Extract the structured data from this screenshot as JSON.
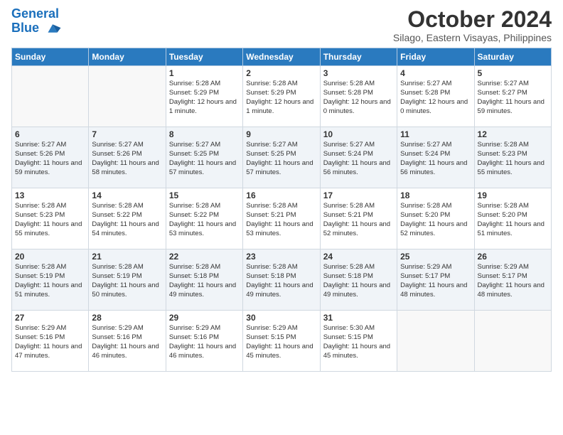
{
  "header": {
    "logo_line1": "General",
    "logo_line2": "Blue",
    "month": "October 2024",
    "location": "Silago, Eastern Visayas, Philippines"
  },
  "days_of_week": [
    "Sunday",
    "Monday",
    "Tuesday",
    "Wednesday",
    "Thursday",
    "Friday",
    "Saturday"
  ],
  "weeks": [
    [
      {
        "day": "",
        "sunrise": "",
        "sunset": "",
        "daylight": ""
      },
      {
        "day": "",
        "sunrise": "",
        "sunset": "",
        "daylight": ""
      },
      {
        "day": "1",
        "sunrise": "Sunrise: 5:28 AM",
        "sunset": "Sunset: 5:29 PM",
        "daylight": "Daylight: 12 hours and 1 minute."
      },
      {
        "day": "2",
        "sunrise": "Sunrise: 5:28 AM",
        "sunset": "Sunset: 5:29 PM",
        "daylight": "Daylight: 12 hours and 1 minute."
      },
      {
        "day": "3",
        "sunrise": "Sunrise: 5:28 AM",
        "sunset": "Sunset: 5:28 PM",
        "daylight": "Daylight: 12 hours and 0 minutes."
      },
      {
        "day": "4",
        "sunrise": "Sunrise: 5:27 AM",
        "sunset": "Sunset: 5:28 PM",
        "daylight": "Daylight: 12 hours and 0 minutes."
      },
      {
        "day": "5",
        "sunrise": "Sunrise: 5:27 AM",
        "sunset": "Sunset: 5:27 PM",
        "daylight": "Daylight: 11 hours and 59 minutes."
      }
    ],
    [
      {
        "day": "6",
        "sunrise": "Sunrise: 5:27 AM",
        "sunset": "Sunset: 5:26 PM",
        "daylight": "Daylight: 11 hours and 59 minutes."
      },
      {
        "day": "7",
        "sunrise": "Sunrise: 5:27 AM",
        "sunset": "Sunset: 5:26 PM",
        "daylight": "Daylight: 11 hours and 58 minutes."
      },
      {
        "day": "8",
        "sunrise": "Sunrise: 5:27 AM",
        "sunset": "Sunset: 5:25 PM",
        "daylight": "Daylight: 11 hours and 57 minutes."
      },
      {
        "day": "9",
        "sunrise": "Sunrise: 5:27 AM",
        "sunset": "Sunset: 5:25 PM",
        "daylight": "Daylight: 11 hours and 57 minutes."
      },
      {
        "day": "10",
        "sunrise": "Sunrise: 5:27 AM",
        "sunset": "Sunset: 5:24 PM",
        "daylight": "Daylight: 11 hours and 56 minutes."
      },
      {
        "day": "11",
        "sunrise": "Sunrise: 5:27 AM",
        "sunset": "Sunset: 5:24 PM",
        "daylight": "Daylight: 11 hours and 56 minutes."
      },
      {
        "day": "12",
        "sunrise": "Sunrise: 5:28 AM",
        "sunset": "Sunset: 5:23 PM",
        "daylight": "Daylight: 11 hours and 55 minutes."
      }
    ],
    [
      {
        "day": "13",
        "sunrise": "Sunrise: 5:28 AM",
        "sunset": "Sunset: 5:23 PM",
        "daylight": "Daylight: 11 hours and 55 minutes."
      },
      {
        "day": "14",
        "sunrise": "Sunrise: 5:28 AM",
        "sunset": "Sunset: 5:22 PM",
        "daylight": "Daylight: 11 hours and 54 minutes."
      },
      {
        "day": "15",
        "sunrise": "Sunrise: 5:28 AM",
        "sunset": "Sunset: 5:22 PM",
        "daylight": "Daylight: 11 hours and 53 minutes."
      },
      {
        "day": "16",
        "sunrise": "Sunrise: 5:28 AM",
        "sunset": "Sunset: 5:21 PM",
        "daylight": "Daylight: 11 hours and 53 minutes."
      },
      {
        "day": "17",
        "sunrise": "Sunrise: 5:28 AM",
        "sunset": "Sunset: 5:21 PM",
        "daylight": "Daylight: 11 hours and 52 minutes."
      },
      {
        "day": "18",
        "sunrise": "Sunrise: 5:28 AM",
        "sunset": "Sunset: 5:20 PM",
        "daylight": "Daylight: 11 hours and 52 minutes."
      },
      {
        "day": "19",
        "sunrise": "Sunrise: 5:28 AM",
        "sunset": "Sunset: 5:20 PM",
        "daylight": "Daylight: 11 hours and 51 minutes."
      }
    ],
    [
      {
        "day": "20",
        "sunrise": "Sunrise: 5:28 AM",
        "sunset": "Sunset: 5:19 PM",
        "daylight": "Daylight: 11 hours and 51 minutes."
      },
      {
        "day": "21",
        "sunrise": "Sunrise: 5:28 AM",
        "sunset": "Sunset: 5:19 PM",
        "daylight": "Daylight: 11 hours and 50 minutes."
      },
      {
        "day": "22",
        "sunrise": "Sunrise: 5:28 AM",
        "sunset": "Sunset: 5:18 PM",
        "daylight": "Daylight: 11 hours and 49 minutes."
      },
      {
        "day": "23",
        "sunrise": "Sunrise: 5:28 AM",
        "sunset": "Sunset: 5:18 PM",
        "daylight": "Daylight: 11 hours and 49 minutes."
      },
      {
        "day": "24",
        "sunrise": "Sunrise: 5:28 AM",
        "sunset": "Sunset: 5:18 PM",
        "daylight": "Daylight: 11 hours and 49 minutes."
      },
      {
        "day": "25",
        "sunrise": "Sunrise: 5:29 AM",
        "sunset": "Sunset: 5:17 PM",
        "daylight": "Daylight: 11 hours and 48 minutes."
      },
      {
        "day": "26",
        "sunrise": "Sunrise: 5:29 AM",
        "sunset": "Sunset: 5:17 PM",
        "daylight": "Daylight: 11 hours and 48 minutes."
      }
    ],
    [
      {
        "day": "27",
        "sunrise": "Sunrise: 5:29 AM",
        "sunset": "Sunset: 5:16 PM",
        "daylight": "Daylight: 11 hours and 47 minutes."
      },
      {
        "day": "28",
        "sunrise": "Sunrise: 5:29 AM",
        "sunset": "Sunset: 5:16 PM",
        "daylight": "Daylight: 11 hours and 46 minutes."
      },
      {
        "day": "29",
        "sunrise": "Sunrise: 5:29 AM",
        "sunset": "Sunset: 5:16 PM",
        "daylight": "Daylight: 11 hours and 46 minutes."
      },
      {
        "day": "30",
        "sunrise": "Sunrise: 5:29 AM",
        "sunset": "Sunset: 5:15 PM",
        "daylight": "Daylight: 11 hours and 45 minutes."
      },
      {
        "day": "31",
        "sunrise": "Sunrise: 5:30 AM",
        "sunset": "Sunset: 5:15 PM",
        "daylight": "Daylight: 11 hours and 45 minutes."
      },
      {
        "day": "",
        "sunrise": "",
        "sunset": "",
        "daylight": ""
      },
      {
        "day": "",
        "sunrise": "",
        "sunset": "",
        "daylight": ""
      }
    ]
  ]
}
